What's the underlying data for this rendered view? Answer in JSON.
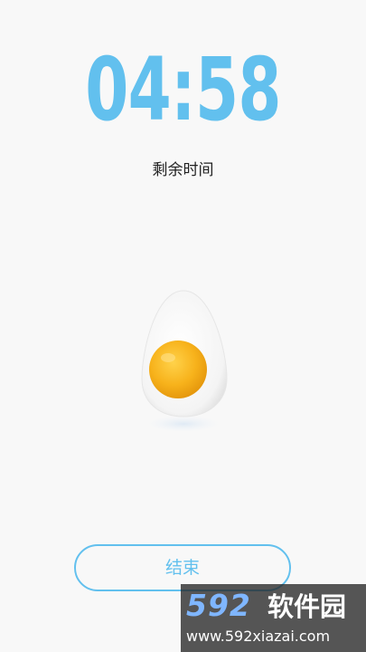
{
  "timer": {
    "remaining": "04:58",
    "label": "剩余时间"
  },
  "actions": {
    "end_label": "结束"
  },
  "watermark": {
    "brand_number": "592",
    "brand_text": "软件园",
    "url": "www.592xiazai.com"
  },
  "colors": {
    "accent": "#62c0ee",
    "background": "#f8f8f8",
    "yolk": "#f7b21b"
  },
  "icons": {
    "egg": "fried-egg-icon"
  }
}
